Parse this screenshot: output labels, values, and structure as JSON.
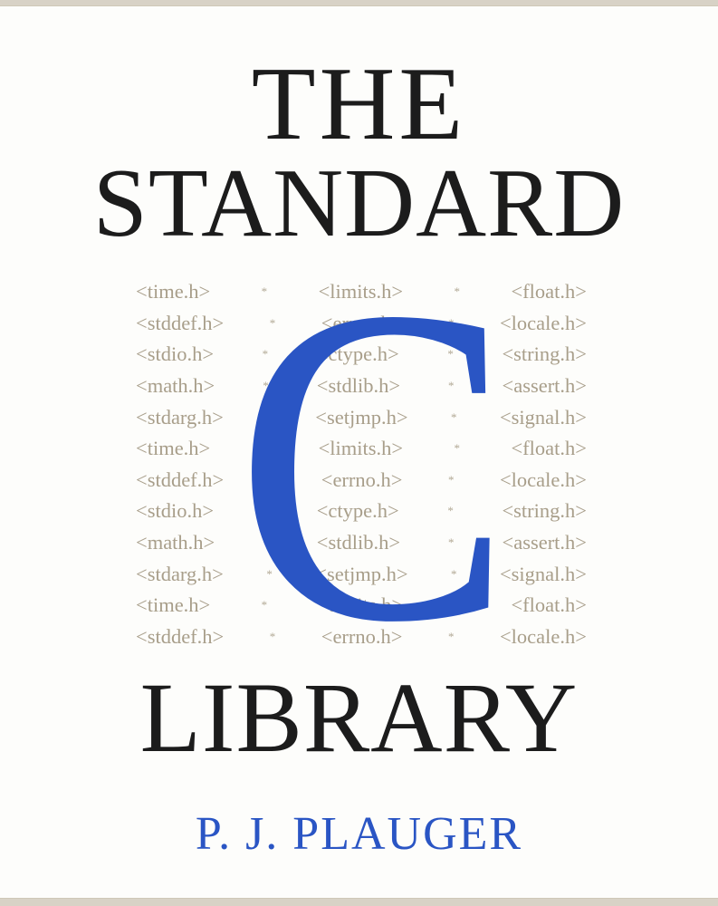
{
  "cover": {
    "title_top": "THE",
    "title_middle": "STANDARD",
    "title_letter": "C",
    "title_bottom": "LIBRARY",
    "author": "P. J. PLAUGER",
    "separator": "*",
    "header_rows": [
      [
        "<time.h>",
        "<limits.h>",
        "<float.h>"
      ],
      [
        "<stddef.h>",
        "<errno.h>",
        "<locale.h>"
      ],
      [
        "<stdio.h>",
        "<ctype.h>",
        "<string.h>"
      ],
      [
        "<math.h>",
        "<stdlib.h>",
        "<assert.h>"
      ],
      [
        "<stdarg.h>",
        "<setjmp.h>",
        "<signal.h>"
      ],
      [
        "<time.h>",
        "<limits.h>",
        "<float.h>"
      ],
      [
        "<stddef.h>",
        "<errno.h>",
        "<locale.h>"
      ],
      [
        "<stdio.h>",
        "<ctype.h>",
        "<string.h>"
      ],
      [
        "<math.h>",
        "<stdlib.h>",
        "<assert.h>"
      ],
      [
        "<stdarg.h>",
        "<setjmp.h>",
        "<signal.h>"
      ],
      [
        "<time.h>",
        "<limits.h>",
        "<float.h>"
      ],
      [
        "<stddef.h>",
        "<errno.h>",
        "<locale.h>"
      ]
    ]
  },
  "colors": {
    "title": "#1c1c1c",
    "accent_blue": "#2a55c4",
    "header_text": "#a89e8a",
    "background": "#fdfdfb"
  }
}
